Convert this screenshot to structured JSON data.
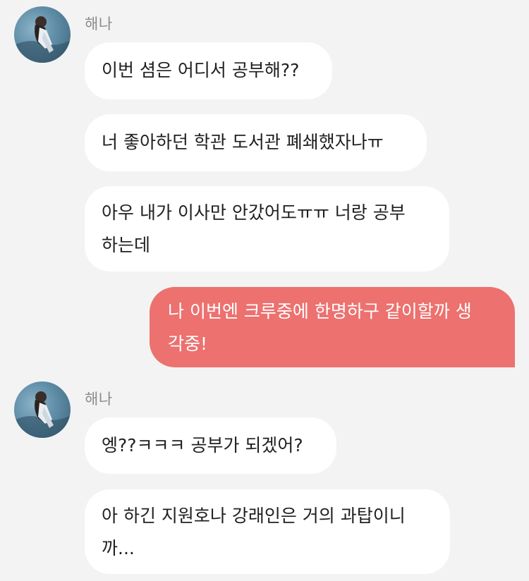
{
  "contact": {
    "name": "해나",
    "avatar_icon": "profile-photo"
  },
  "colors": {
    "background": "#f3f3f3",
    "incoming_bubble": "#ffffff",
    "outgoing_bubble": "#ec716f",
    "sender_name": "#8b8b8b"
  },
  "messages": [
    {
      "sender": "해나",
      "direction": "incoming",
      "text": "이번 셤은 어디서 공부해??"
    },
    {
      "sender": "해나",
      "direction": "incoming",
      "text": "너 좋아하던 학관 도서관 폐쇄했자나ㅠ"
    },
    {
      "sender": "해나",
      "direction": "incoming",
      "text_line1": "아우 내가 이사만 안갔어도ㅠㅠ 너랑 공부",
      "text_line2": "하는데"
    },
    {
      "sender": "me",
      "direction": "outgoing",
      "text_line1": "나 이번엔 크루중에 한명하구 같이할까 생",
      "text_line2": "각중!"
    },
    {
      "sender": "해나",
      "direction": "incoming",
      "text": "엥??ㅋㅋㅋ 공부가 되겠어?"
    },
    {
      "sender": "해나",
      "direction": "incoming",
      "text_line1": "아 하긴 지원호나 강래인은 거의 과탑이니",
      "text_line2": "까..."
    }
  ]
}
